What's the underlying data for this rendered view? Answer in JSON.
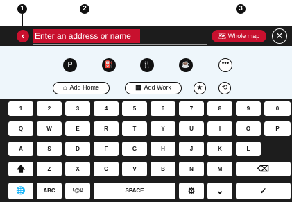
{
  "callouts": [
    "1",
    "2",
    "3"
  ],
  "header": {
    "back_icon": "‹",
    "search_placeholder": "Enter an address or name",
    "whole_map_icon": "🗺",
    "whole_map_label": "Whole map",
    "close_icon": "✕"
  },
  "poi_categories": [
    {
      "name": "parking",
      "glyph": "P"
    },
    {
      "name": "fuel",
      "glyph": "⛽"
    },
    {
      "name": "restaurant",
      "glyph": "🍴"
    },
    {
      "name": "cafe",
      "glyph": "☕"
    },
    {
      "name": "more",
      "glyph": "•••"
    }
  ],
  "shortcuts": {
    "add_home": "Add Home",
    "add_home_icon": "⌂",
    "add_work": "Add Work",
    "add_work_icon": "▦",
    "favorites_icon": "★",
    "history_icon": "⟲"
  },
  "keyboard": {
    "row1": [
      "1",
      "2",
      "3",
      "4",
      "5",
      "6",
      "7",
      "8",
      "9",
      "0"
    ],
    "row2": [
      "Q",
      "W",
      "E",
      "R",
      "T",
      "Y",
      "U",
      "I",
      "O",
      "P"
    ],
    "row3": [
      "A",
      "S",
      "D",
      "F",
      "G",
      "H",
      "J",
      "K",
      "L"
    ],
    "shift": "🡅",
    "row4": [
      "Z",
      "X",
      "C",
      "V",
      "B",
      "N",
      "M"
    ],
    "backspace": "⌫",
    "globe": "🌐",
    "abc": "ABC",
    "symbols": "!@#",
    "space": "SPACE",
    "settings": "⚙",
    "hide": "⌄",
    "done": "✓"
  }
}
